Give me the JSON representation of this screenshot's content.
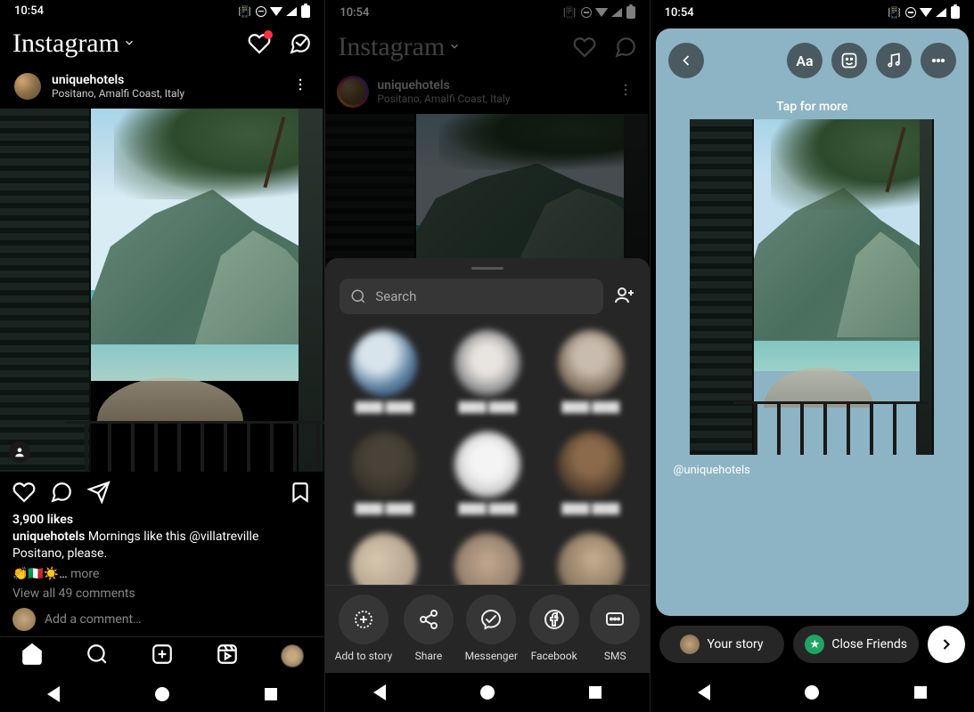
{
  "status": {
    "time": "10:54"
  },
  "header": {
    "logo": "Instagram"
  },
  "post": {
    "username": "uniquehotels",
    "location": "Positano, Amalfi Coast, Italy",
    "likes": "3,900 likes",
    "caption_user": "uniquehotels",
    "caption_text": " Mornings like this @villatreville Positano, please.",
    "emoji_line": "👏🇮🇹☀️…",
    "more": " more",
    "view_comments": "View all 49 comments",
    "add_comment": "Add a comment…"
  },
  "share": {
    "search_placeholder": "Search",
    "options": {
      "add_story": "Add to story",
      "share": "Share",
      "messenger": "Messenger",
      "facebook": "Facebook",
      "sms": "SMS"
    }
  },
  "story": {
    "tap_more": "Tap for more",
    "attribution": "@uniquehotels",
    "your_story": "Your story",
    "close_friends": "Close Friends"
  }
}
